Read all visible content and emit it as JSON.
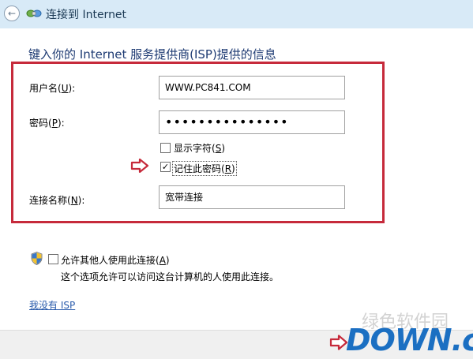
{
  "window": {
    "title": "连接到 Internet"
  },
  "heading": "键入你的 Internet 服务提供商(ISP)提供的信息",
  "form": {
    "username": {
      "label_prefix": "用户名(",
      "label_key": "U",
      "label_suffix": "):",
      "value": "WWW.PC841.COM"
    },
    "password": {
      "label_prefix": "密码(",
      "label_key": "P",
      "label_suffix": "):",
      "value": "•••••••••••••••"
    },
    "show_chars": {
      "label_prefix": "显示字符(",
      "label_key": "S",
      "label_suffix": ")",
      "checked": false
    },
    "remember": {
      "label_prefix": "记住此密码(",
      "label_key": "R",
      "label_suffix": ")",
      "checked": true
    },
    "connection_name": {
      "label_prefix": "连接名称(",
      "label_key": "N",
      "label_suffix": "):",
      "value": "宽带连接"
    }
  },
  "allow_others": {
    "label_prefix": "允许其他人使用此连接(",
    "label_key": "A",
    "label_suffix": ")",
    "checked": false,
    "description": "这个选项允许可以访问这台计算机的人使用此连接。"
  },
  "no_isp_link": "我没有 ISP",
  "watermark": {
    "logo": "DOWN.cc",
    "faded": "绿色软件园"
  },
  "colors": {
    "highlight_box": "#c62a3b",
    "titlebar": "#d8eaf7",
    "heading": "#1e3b73",
    "link": "#2a5bab",
    "logo": "#1b6fc2"
  },
  "icons": {
    "back": "back-arrow-icon",
    "network": "network-connection-icon",
    "shield": "uac-shield-icon",
    "pointer": "red-arrow-icon"
  }
}
